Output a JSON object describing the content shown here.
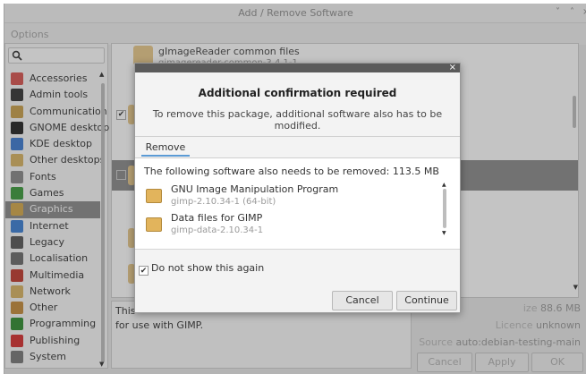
{
  "window": {
    "title": "Add / Remove Software",
    "controls": [
      "˅",
      "˄",
      "×"
    ],
    "menu": "Options"
  },
  "sidebar": {
    "categories": [
      {
        "label": "Accessories",
        "icon": "accessories-icon",
        "color": "#d9534f"
      },
      {
        "label": "Admin tools",
        "icon": "admin-tools-icon",
        "color": "#333333"
      },
      {
        "label": "Communication",
        "icon": "communication-icon",
        "color": "#c9a04a"
      },
      {
        "label": "GNOME desktop",
        "icon": "gnome-foot-icon",
        "color": "#222222"
      },
      {
        "label": "KDE desktop",
        "icon": "kde-icon",
        "color": "#3b7ad1"
      },
      {
        "label": "Other desktops",
        "icon": "folder-icon",
        "color": "#d8b462"
      },
      {
        "label": "Fonts",
        "icon": "fonts-icon",
        "color": "#888888"
      },
      {
        "label": "Games",
        "icon": "games-icon",
        "color": "#3a9a3a"
      },
      {
        "label": "Graphics",
        "icon": "graphics-icon",
        "color": "#d4a84a"
      },
      {
        "label": "Internet",
        "icon": "internet-icon",
        "color": "#3a7fd5"
      },
      {
        "label": "Legacy",
        "icon": "legacy-icon",
        "color": "#555555"
      },
      {
        "label": "Localisation",
        "icon": "localisation-icon",
        "color": "#6a6a6a"
      },
      {
        "label": "Multimedia",
        "icon": "multimedia-icon",
        "color": "#c0392b"
      },
      {
        "label": "Network",
        "icon": "network-icon",
        "color": "#d8b462"
      },
      {
        "label": "Other",
        "icon": "other-icon",
        "color": "#c58b3a"
      },
      {
        "label": "Programming",
        "icon": "programming-icon",
        "color": "#2e8b2e"
      },
      {
        "label": "Publishing",
        "icon": "publishing-icon",
        "color": "#d62d2d"
      },
      {
        "label": "System",
        "icon": "system-icon",
        "color": "#777777"
      }
    ],
    "selected_index": 8
  },
  "packages": {
    "top_name": "gImageReader common files",
    "top_version": "gimagereader-common-3.4.1-1"
  },
  "description": {
    "line1": "This",
    "line2": "for use with GIMP."
  },
  "info": {
    "size_label": "ize",
    "size_value": "88.6 MB",
    "licence_label": "Licence",
    "licence_value": "unknown",
    "source_label": "Source",
    "source_value": "auto:debian-testing-main"
  },
  "bottom_buttons": {
    "cancel": "Cancel",
    "apply": "Apply",
    "ok": "OK"
  },
  "dialog": {
    "close": "×",
    "heading": "Additional confirmation required",
    "subtitle": "To remove this package, additional software also has to be modified.",
    "tab": "Remove",
    "message": "The following software also needs to be removed: 113.5 MB",
    "dependencies": [
      {
        "name": "GNU Image Manipulation Program",
        "version": "gimp-2.10.34-1 (64-bit)"
      },
      {
        "name": "Data files for GIMP",
        "version": "gimp-data-2.10.34-1"
      }
    ],
    "dont_show": "Do not show this again",
    "dont_show_checked": true,
    "cancel": "Cancel",
    "continue": "Continue"
  }
}
